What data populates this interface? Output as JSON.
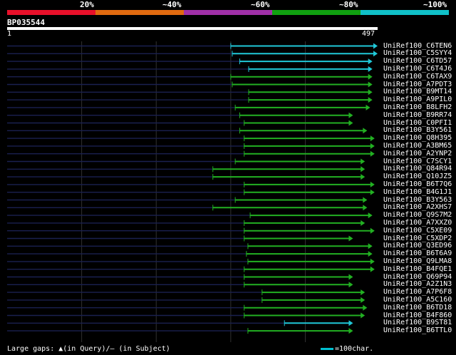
{
  "header": {
    "percent_labels": [
      "20%",
      "~40%",
      "~60%",
      "~80%",
      "~100%"
    ],
    "colors": [
      "#e8102a",
      "#e06a10",
      "#a030a8",
      "#10a010",
      "#10c0c8"
    ]
  },
  "query": {
    "id": "BP035544",
    "start_label": "1",
    "end_label": "497",
    "length": 497
  },
  "hits": [
    {
      "name": "UniRef100_C6TEN6",
      "start": 300,
      "end": 497,
      "color": "cyan"
    },
    {
      "name": "UniRef100_C5SYY4",
      "start": 302,
      "end": 497,
      "color": "cyan"
    },
    {
      "name": "UniRef100_C6TD57",
      "start": 312,
      "end": 490,
      "color": "cyan"
    },
    {
      "name": "UniRef100_C6T4J6",
      "start": 324,
      "end": 490,
      "color": "cyan"
    },
    {
      "name": "UniRef100_C6TAX9",
      "start": 300,
      "end": 490,
      "color": "green"
    },
    {
      "name": "UniRef100_A7PDT3",
      "start": 302,
      "end": 490,
      "color": "green"
    },
    {
      "name": "UniRef100_B9MT14",
      "start": 324,
      "end": 490,
      "color": "green"
    },
    {
      "name": "UniRef100_A9PIL0",
      "start": 324,
      "end": 490,
      "color": "green"
    },
    {
      "name": "UniRef100_B8LFH2",
      "start": 306,
      "end": 487,
      "color": "green"
    },
    {
      "name": "UniRef100_B9RR74",
      "start": 312,
      "end": 464,
      "color": "green"
    },
    {
      "name": "UniRef100_C0PFI1",
      "start": 318,
      "end": 464,
      "color": "green"
    },
    {
      "name": "UniRef100_B3Y561",
      "start": 312,
      "end": 483,
      "color": "green"
    },
    {
      "name": "UniRef100_Q8H395",
      "start": 318,
      "end": 493,
      "color": "green"
    },
    {
      "name": "UniRef100_A3BM65",
      "start": 318,
      "end": 493,
      "color": "green"
    },
    {
      "name": "UniRef100_A2YNP2",
      "start": 318,
      "end": 493,
      "color": "green"
    },
    {
      "name": "UniRef100_C7SCY1",
      "start": 306,
      "end": 480,
      "color": "green"
    },
    {
      "name": "UniRef100_Q84R94",
      "start": 276,
      "end": 480,
      "color": "green"
    },
    {
      "name": "UniRef100_Q10JZ5",
      "start": 276,
      "end": 480,
      "color": "green"
    },
    {
      "name": "UniRef100_B6T7Q6",
      "start": 318,
      "end": 493,
      "color": "green"
    },
    {
      "name": "UniRef100_B4G1J1",
      "start": 318,
      "end": 493,
      "color": "green"
    },
    {
      "name": "UniRef100_B3Y563",
      "start": 306,
      "end": 483,
      "color": "green"
    },
    {
      "name": "UniRef100_A2XHS7",
      "start": 276,
      "end": 483,
      "color": "green"
    },
    {
      "name": "UniRef100_Q9S7M2",
      "start": 326,
      "end": 490,
      "color": "green"
    },
    {
      "name": "UniRef100_A7XXZ0",
      "start": 318,
      "end": 480,
      "color": "green"
    },
    {
      "name": "UniRef100_C5XE09",
      "start": 318,
      "end": 493,
      "color": "green"
    },
    {
      "name": "UniRef100_C5XDP2",
      "start": 318,
      "end": 464,
      "color": "green"
    },
    {
      "name": "UniRef100_Q3ED96",
      "start": 323,
      "end": 490,
      "color": "green"
    },
    {
      "name": "UniRef100_B6T6A9",
      "start": 321,
      "end": 490,
      "color": "green"
    },
    {
      "name": "UniRef100_Q9LMA8",
      "start": 323,
      "end": 493,
      "color": "green"
    },
    {
      "name": "UniRef100_B4FQE1",
      "start": 318,
      "end": 493,
      "color": "green"
    },
    {
      "name": "UniRef100_Q69P94",
      "start": 318,
      "end": 464,
      "color": "green"
    },
    {
      "name": "UniRef100_A2Z1N3",
      "start": 318,
      "end": 464,
      "color": "green"
    },
    {
      "name": "UniRef100_A7P6F8",
      "start": 342,
      "end": 480,
      "color": "green"
    },
    {
      "name": "UniRef100_A5C160",
      "start": 342,
      "end": 480,
      "color": "green"
    },
    {
      "name": "UniRef100_B6TD18",
      "start": 318,
      "end": 483,
      "color": "green"
    },
    {
      "name": "UniRef100_B4F860",
      "start": 318,
      "end": 480,
      "color": "green"
    },
    {
      "name": "UniRef100_B9ST81",
      "start": 372,
      "end": 464,
      "color": "cyan"
    },
    {
      "name": "UniRef100_B6TTL0",
      "start": 323,
      "end": 464,
      "color": "green"
    }
  ],
  "legend": {
    "large_gaps": "Large gaps: ▲(in Query)/– (in Subject)",
    "scale": "=100char."
  }
}
